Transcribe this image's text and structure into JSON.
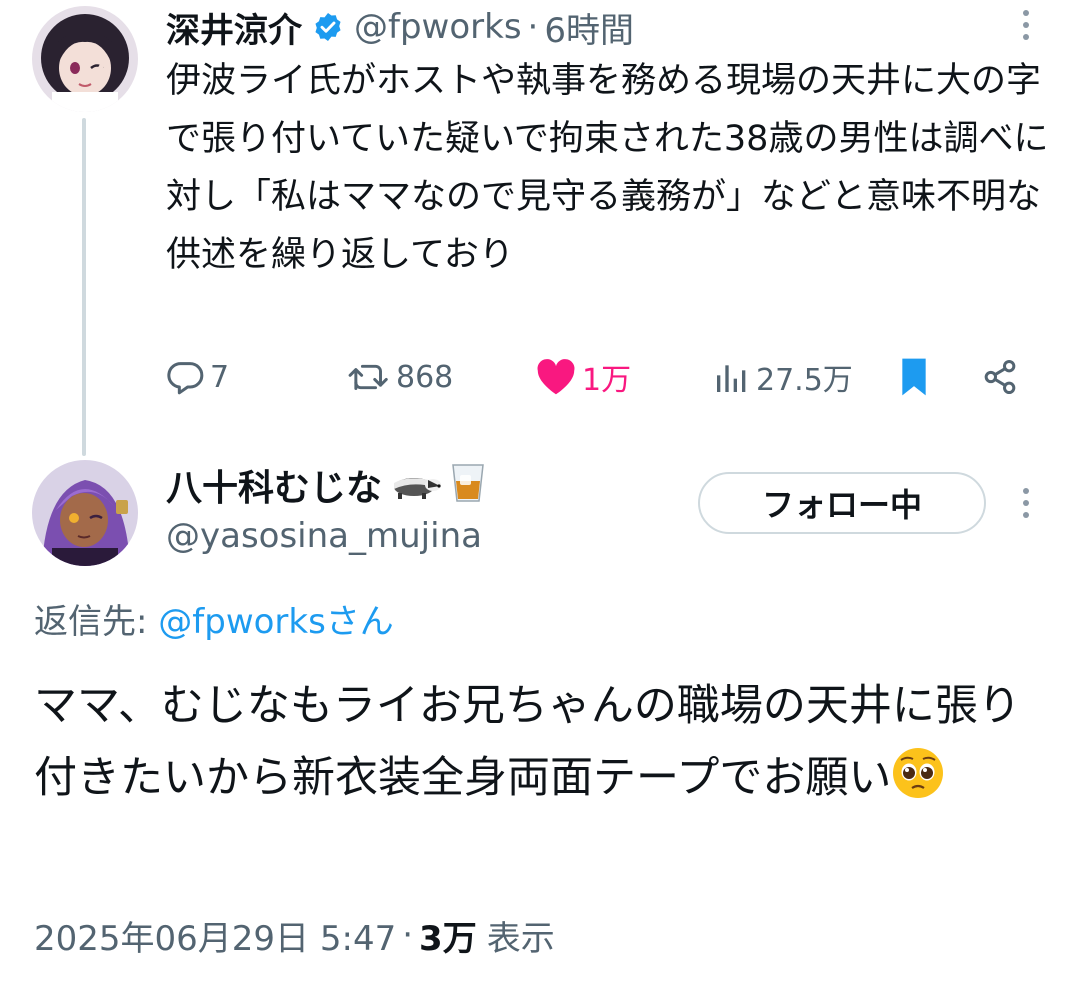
{
  "tweet1": {
    "author_name": "深井涼介",
    "handle": "@fpworks",
    "separator": "·",
    "time": "6時間",
    "body": "伊波ライ氏がホストや執事を務める現場の天井に大の字で張り付いていた疑いで拘束された38歳の男性は調べに対し「私はママなので見守る義務が」などと意味不明な供述を繰り返しており",
    "actions": {
      "replies": "7",
      "retweets": "868",
      "likes": "1万",
      "views": "27.5万"
    }
  },
  "tweet2": {
    "author_name": "八十科むじな",
    "name_emojis": [
      "badger-icon",
      "whiskey-glass-icon"
    ],
    "handle": "@yasosina_mujina",
    "follow_label": "フォロー中",
    "reply_prefix": "返信先: ",
    "reply_to": "@fpworksさん",
    "body": "ママ、むじなもライお兄ちゃんの職場の天井に張り付きたいから新衣装全身両面テープでお願い",
    "body_emoji": "pleading-face-icon",
    "date": "2025年06月29日 5:47",
    "separator": "·",
    "views_count": "3万",
    "views_label": "表示"
  },
  "colors": {
    "text": "#0f1419",
    "secondary": "#536471",
    "link": "#1d9bf0",
    "like": "#f91880",
    "bookmark": "#1d9bf0",
    "verified": "#1d9bf0"
  }
}
